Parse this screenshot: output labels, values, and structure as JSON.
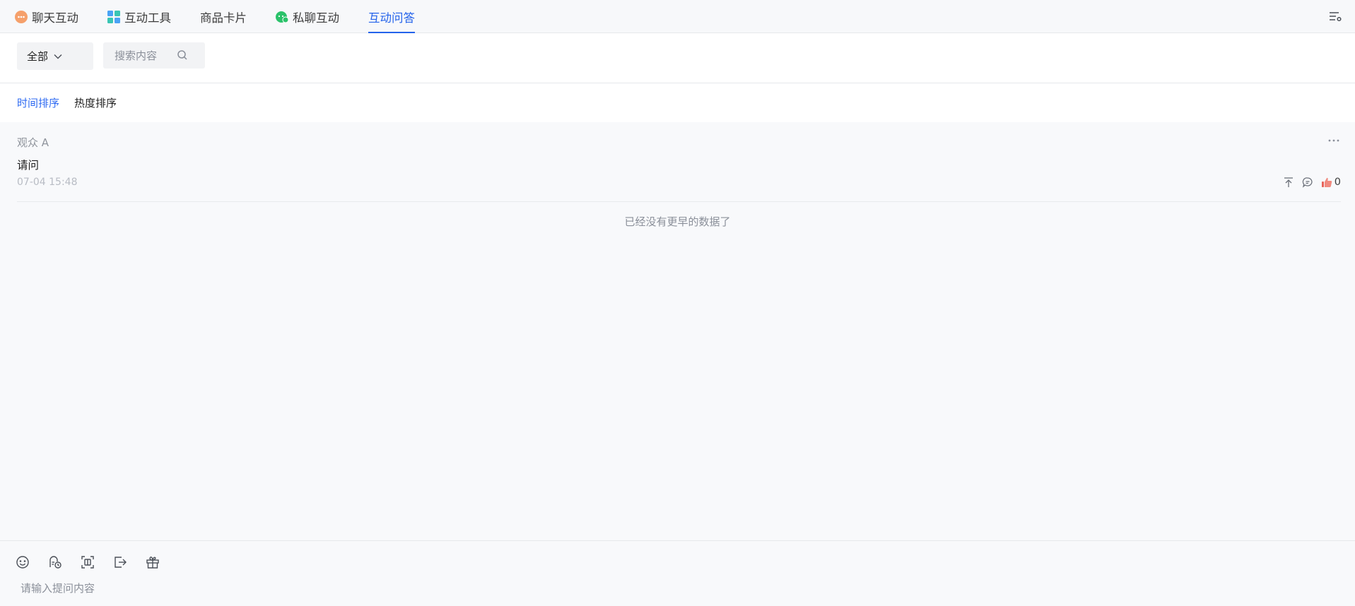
{
  "tabs": [
    {
      "label": "聊天互动",
      "icon": "chat-bubble-icon",
      "active": false
    },
    {
      "label": "互动工具",
      "icon": "grid-tools-icon",
      "active": false
    },
    {
      "label": "商品卡片",
      "icon": "",
      "active": false
    },
    {
      "label": "私聊互动",
      "icon": "wechat-icon",
      "active": false
    },
    {
      "label": "互动问答",
      "icon": "",
      "active": true
    }
  ],
  "filter": {
    "select_value": "全部",
    "search_placeholder": "搜索内容"
  },
  "sort": {
    "time_label": "时间排序",
    "hot_label": "热度排序",
    "active": "time"
  },
  "questions": [
    {
      "author": "观众 A",
      "text": "请问",
      "time": "07-04 15:48",
      "likes": "0"
    }
  ],
  "no_more_text": "已经没有更早的数据了",
  "composer": {
    "placeholder": "请输入提问内容",
    "tools": [
      "emoji-icon",
      "record-icon",
      "screenshot-icon",
      "exit-icon",
      "gift-icon"
    ]
  },
  "colors": {
    "accent": "#2463eb",
    "chat_icon": "#f5a06b",
    "wechat_icon": "#2bc26a"
  }
}
